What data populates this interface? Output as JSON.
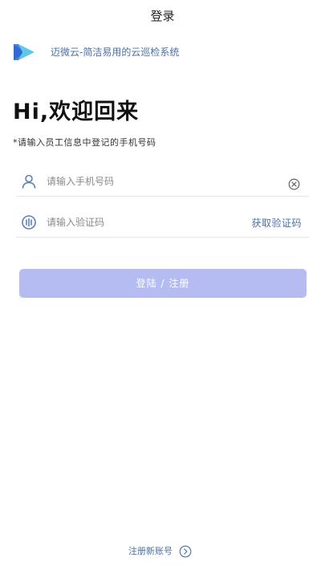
{
  "header": {
    "title": "登录"
  },
  "brand": {
    "text": "迈微云-简洁易用的云巡检系统",
    "logo_icon": "brand-logo-icon"
  },
  "welcome": {
    "heading": "Hi,欢迎回来",
    "hint": "*请输入员工信息中登记的手机号码"
  },
  "form": {
    "phone": {
      "placeholder": "请输入手机号码",
      "value": "",
      "icon": "user-icon",
      "clear_icon": "clear-icon"
    },
    "code": {
      "placeholder": "请输入验证码",
      "value": "",
      "icon": "verification-icon",
      "get_code_label": "获取验证码"
    },
    "submit_label": "登陆 / 注册"
  },
  "footer": {
    "register_label": "注册新账号",
    "register_icon": "chevron-right-circle-icon"
  },
  "colors": {
    "accent_text": "#4b6fa8",
    "button_bg": "#b5bcf2",
    "logo_blue": "#2f6bd8",
    "logo_cyan": "#5ec8e8"
  }
}
